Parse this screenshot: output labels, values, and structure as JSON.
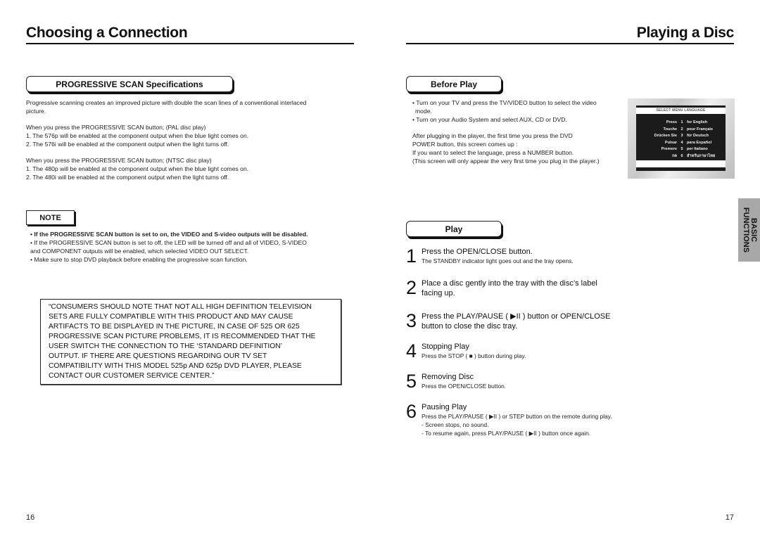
{
  "left_page": {
    "title": "Choosing a Connection",
    "section_header": "PROGRESSIVE SCAN Specifications",
    "intro_lines": [
      "Progressive scanning creates an improved picture with double the scan lines of a conventional interlaced",
      "picture."
    ],
    "pal": {
      "heading": "When you press the PROGRESSIVE SCAN button; (PAL disc play)",
      "items": [
        "1. The 576p will be enabled at the component output when the blue light comes on.",
        "2. The 576i will be enabled at the component output when the light turns off."
      ]
    },
    "ntsc": {
      "heading": "When you press the PROGRESSIVE SCAN button; (NTSC disc play)",
      "items": [
        "1. The 480p will be enabled at the component output when the blue light comes on.",
        "2. The 480i will be enabled at the component output when the light turns off."
      ]
    },
    "note": {
      "label": "NOTE",
      "bold_line": "• If the PROGRESSIVE SCAN button is set to on, the VIDEO and S-video outputs will be disabled.",
      "lines": [
        "• If the PROGRESSIVE SCAN button is set to off, the LED will be turned off and all of VIDEO, S-VIDEO",
        "and COMPONENT outputs will be enabled, which selected VIDEO OUT SELECT.",
        "• Make sure to stop DVD playback before enabling the progressive scan function."
      ]
    },
    "caution_lines": [
      "“CONSUMERS SHOULD NOTE THAT NOT ALL  HIGH DEFINITION TELEVISION",
      "SETS ARE FULLY COMPATIBLE WITH THIS PRODUCT AND MAY CAUSE",
      "ARTIFACTS TO BE DISPLAYED IN THE PICTURE, IN CASE OF 525 OR 625",
      "PROGRESSIVE SCAN PICTURE PROBLEMS, IT IS RECOMMENDED THAT THE",
      "USER SWITCH THE CONNECTION TO THE ‘STANDARD DEFINITION’",
      "OUTPUT. IF THERE ARE QUESTIONS REGARDING OUR TV SET",
      "COMPATIBILITY WITH THIS MODEL 525p AND 625p DVD PLAYER, PLEASE",
      "CONTACT OUR CUSTOMER SERVICE CENTER.”"
    ],
    "page_number": "16"
  },
  "right_page": {
    "title": "Playing a Disc",
    "before_play": {
      "header": "Before Play",
      "bullets": [
        "• Turn on your TV and press the TV/VIDEO button to select the video",
        "  mode.",
        "• Turn on your Audio System and select AUX, CD or DVD."
      ],
      "lines": [
        "After plugging in the player, the first time you press the DVD",
        "POWER button, this screen comes up :",
        "If you want to select the language, press a NUMBER button.",
        "(This screen will only appear the very first time you plug in the player.)"
      ]
    },
    "tv_screen": {
      "title": "SELECT MENU LANGUAGE",
      "rows": [
        {
          "word": "Press",
          "num": "1",
          "lang": "for English"
        },
        {
          "word": "Touche",
          "num": "2",
          "lang": "pour Français"
        },
        {
          "word": "Drücken Sie",
          "num": "3",
          "lang": "für Deutsch"
        },
        {
          "word": "Pulsar",
          "num": "4",
          "lang": "para Español"
        },
        {
          "word": "Premere",
          "num": "5",
          "lang": "per Italiano"
        },
        {
          "word": "กด",
          "num": "6",
          "lang": "สำหรับภาษาไทย"
        }
      ]
    },
    "play": {
      "header": "Play",
      "steps": [
        {
          "num": "1",
          "head": "Press the OPEN/CLOSE button.",
          "sub": [
            "The STANDBY indicator light goes out and the tray opens."
          ]
        },
        {
          "num": "2",
          "head": "Place a disc gently into the tray with the disc’s label",
          "head2": "facing up.",
          "sub": []
        },
        {
          "num": "3",
          "head": "Press the PLAY/PAUSE ( ▶II ) button or OPEN/CLOSE",
          "head2": "button to close the disc tray.",
          "sub": []
        },
        {
          "num": "4",
          "head": "Stopping Play",
          "sub": [
            "Press the STOP ( ■ ) button during play."
          ]
        },
        {
          "num": "5",
          "head": "Removing Disc",
          "sub": [
            "Press the OPEN/CLOSE button."
          ]
        },
        {
          "num": "6",
          "head": "Pausing Play",
          "sub": [
            "Press the PLAY/PAUSE ( ▶II ) or STEP button on the remote during play.",
            "- Screen stops, no sound.",
            "- To resume again, press PLAY/PAUSE ( ▶II ) button once again."
          ]
        }
      ]
    },
    "side_tab": {
      "line1": "BASIC",
      "line2": "FUNCTIONS"
    },
    "page_number": "17"
  }
}
